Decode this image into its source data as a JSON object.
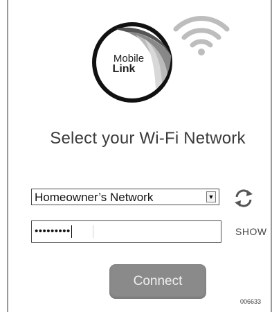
{
  "logo": {
    "line1": "Mobile",
    "line2": "Link"
  },
  "title": "Select your Wi-Fi Network",
  "network_select": {
    "selected": "Homeowner’s Network",
    "arrow_glyph": "▼"
  },
  "password_field": {
    "masked_value": "•••••••••"
  },
  "show_label": "SHOW",
  "connect_label": "Connect",
  "figure_ref": "006633",
  "icons": [
    "mobile-link-logo",
    "wifi-icon",
    "refresh-icon"
  ],
  "colors": {
    "button": "#8a8a8a",
    "text": "#3a3a3a",
    "border": "#4a4a4a",
    "wifi": "#bdbdbd"
  }
}
